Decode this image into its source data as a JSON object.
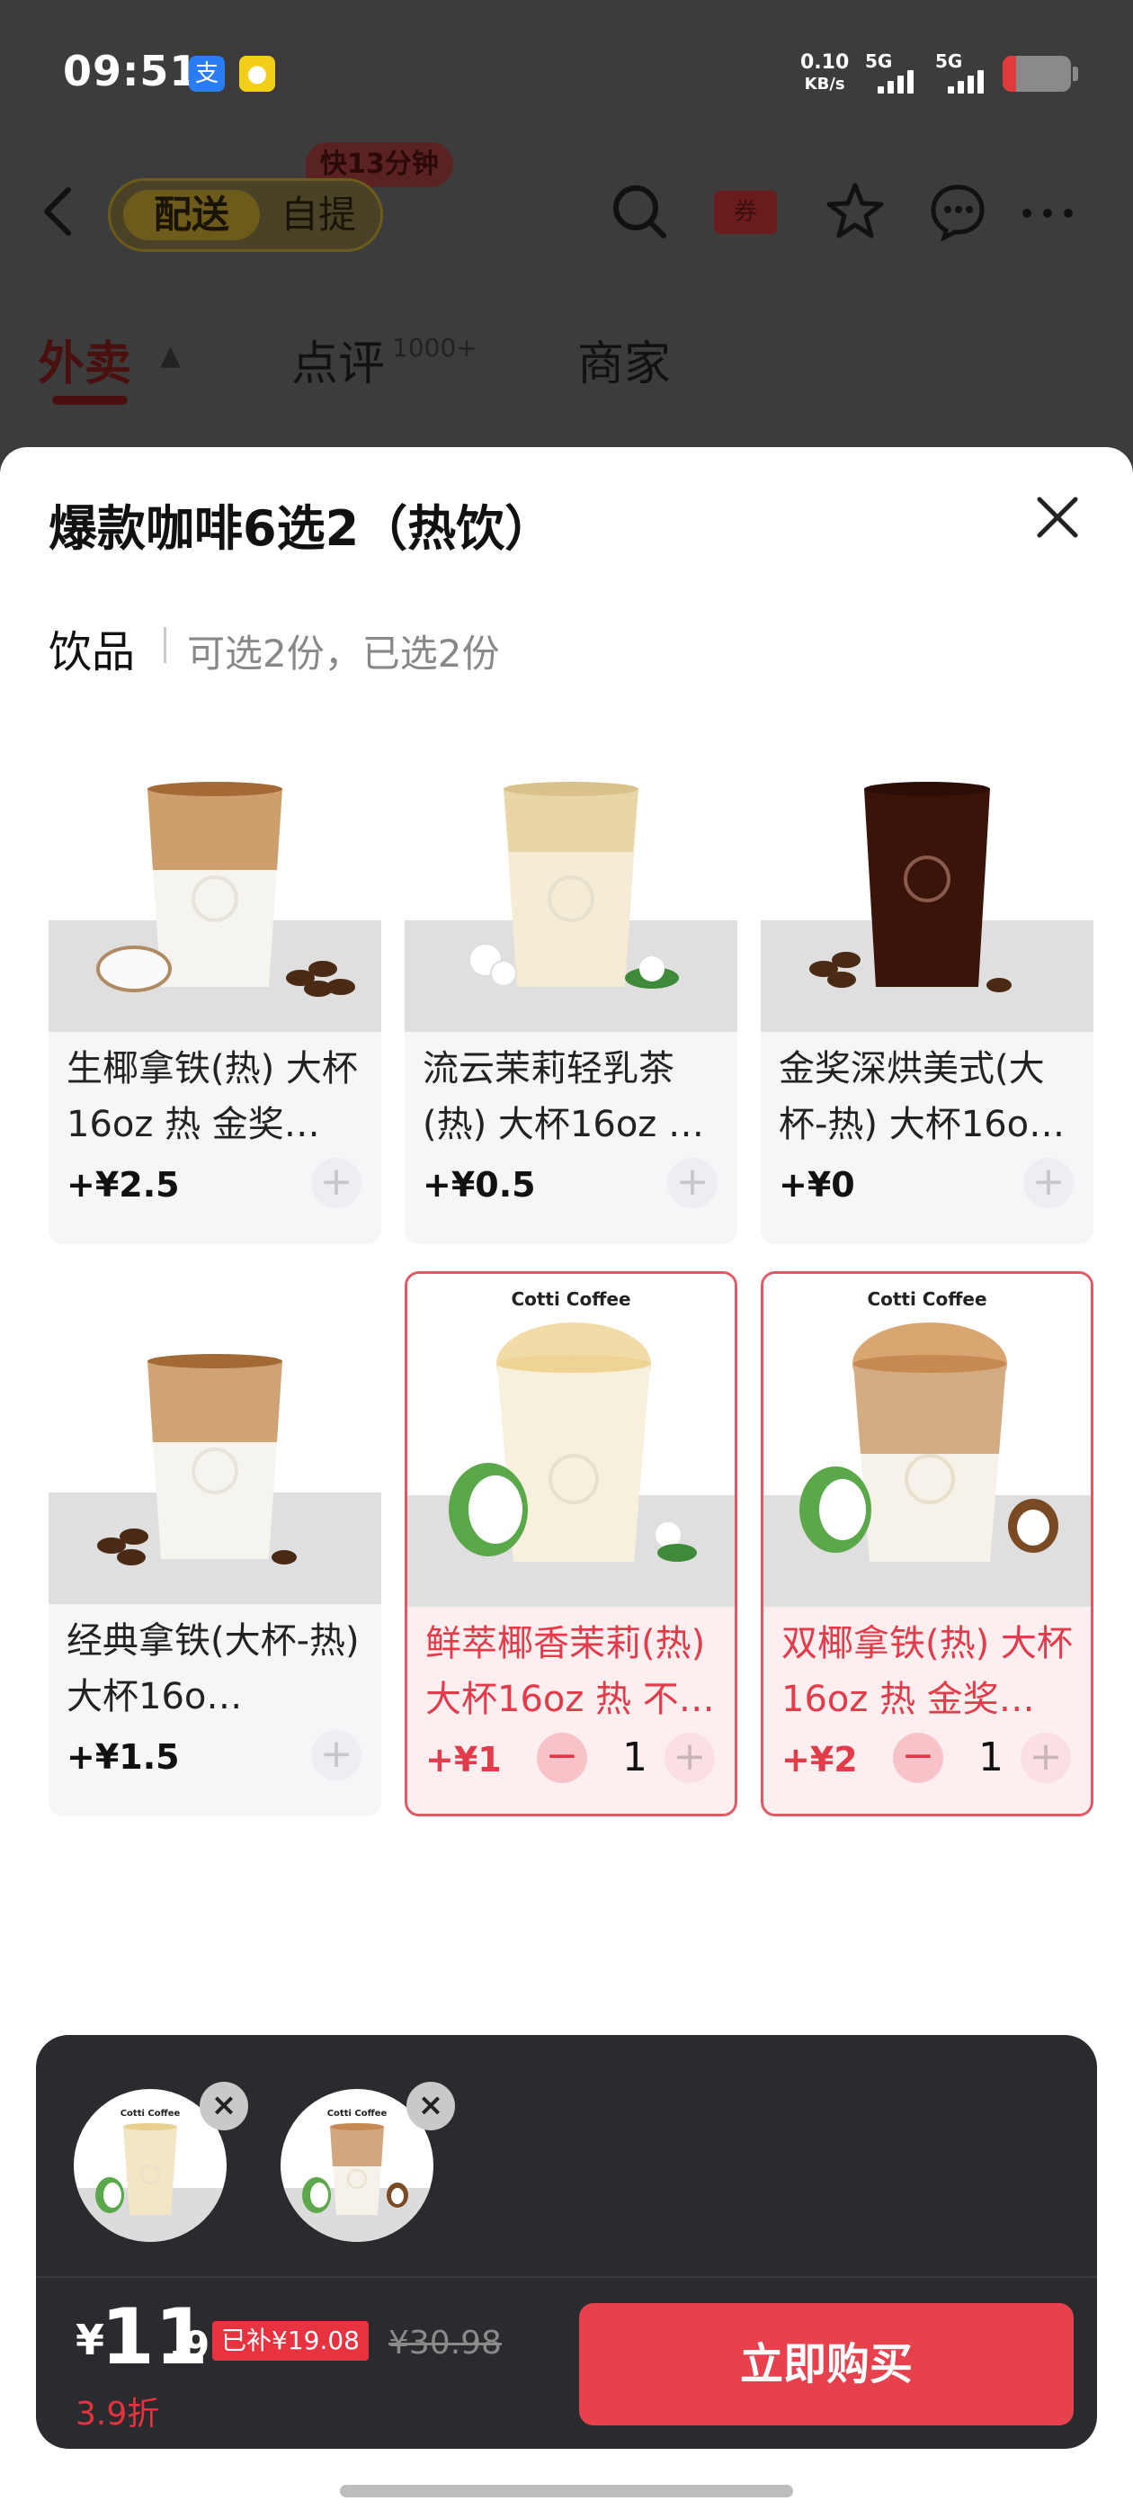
{
  "status_bar": {
    "time": "09:51",
    "alipay_glyph": "支",
    "net_speed_value": "0.10",
    "net_speed_unit": "KB/s",
    "sig1_label": "5G",
    "sig2_label": "5G",
    "battery_level": 0.2
  },
  "header": {
    "fast_badge": "快13分钟",
    "mode_on": "配送",
    "mode_off": "自提",
    "coupon_label": "券",
    "tabs": [
      {
        "label": "外卖"
      },
      {
        "label": "点评",
        "badge": "1000+"
      },
      {
        "label": "商家"
      }
    ]
  },
  "sheet": {
    "title": "爆款咖啡6选2（热饮）",
    "section_label": "饮品",
    "section_sub": "可选2份，已选2份"
  },
  "products": [
    {
      "name": "生椰拿铁(热) 大杯16oz 热 金奖…",
      "price": "+¥2.5",
      "selected": false
    },
    {
      "name": "流云茉莉轻乳茶(热) 大杯16oz …",
      "price": "+¥0.5",
      "selected": false
    },
    {
      "name": "金奖深烘美式(大杯-热) 大杯16o…",
      "price": "+¥0",
      "selected": false
    },
    {
      "name": "经典拿铁(大杯-热) 大杯16o…",
      "price": "+¥1.5",
      "selected": false
    },
    {
      "name": "鲜萃椰香茉莉(热) 大杯16oz 热 不…",
      "price": "+¥1",
      "selected": true,
      "qty": "1",
      "brand": "Cotti Coffee"
    },
    {
      "name": "双椰拿铁(热) 大杯16oz 热 金奖…",
      "price": "+¥2",
      "selected": true,
      "qty": "1",
      "brand": "Cotti Coffee"
    }
  ],
  "cart": {
    "thumb_brand": "Cotti Coffee",
    "currency": "¥",
    "price_int": "11",
    "price_dec": ".9",
    "subsidy_badge": "已补¥19.08",
    "original_price": "¥30.98",
    "discount": "3.9折",
    "buy_label": "立即购买"
  },
  "colors": {
    "accent": "#e6414d",
    "selected_border": "#e05a66",
    "panel": "#2a2b2e"
  }
}
